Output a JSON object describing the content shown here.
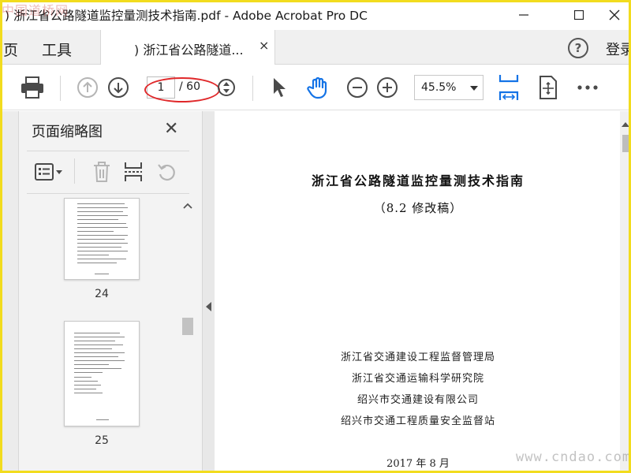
{
  "window": {
    "title": ") 浙江省公路隧道监控量测技术指南.pdf - Adobe Acrobat Pro DC",
    "minimize": "—",
    "maximize": "☐",
    "close": "✕"
  },
  "watermarks": {
    "top_left": "中国道桥网",
    "bottom_right": "www.cndao.com"
  },
  "tabs": {
    "home": "页",
    "tools": "工具",
    "document": ") 浙江省公路隧道...",
    "document_close": "×",
    "sign_in": "登录"
  },
  "toolbar": {
    "icons": [
      "print-icon",
      "page-up-icon",
      "page-down-icon",
      "page-nav-icon",
      "select-cursor-icon",
      "hand-icon",
      "zoom-out-icon",
      "zoom-in-icon",
      "fit-page-icon",
      "scroll-mode-icon",
      "more-icon"
    ],
    "current_page": "1",
    "total_pages": "/ 60",
    "zoom": "45.5%"
  },
  "thumbnails": {
    "title": "页面缩略图",
    "close": "✕",
    "tool_icons": [
      "thumbnail-options-icon",
      "delete-icon",
      "insert-page-icon",
      "rotate-icon"
    ],
    "pages": [
      {
        "number": "24"
      },
      {
        "number": "25"
      }
    ]
  },
  "document": {
    "title": "浙江省公路隧道监控量测技术指南",
    "subtitle": "（8.2 修改稿）",
    "organizations": [
      "浙江省交通建设工程监督管理局",
      "浙江省交通运输科学研究院",
      "绍兴市交通建设有限公司",
      "绍兴市交通工程质量安全监督站"
    ],
    "date": "2017 年 8 月"
  },
  "colors": {
    "accent_blue": "#1473e6",
    "annotation_red": "#e0282a",
    "frame_yellow": "#f2dc1e"
  }
}
